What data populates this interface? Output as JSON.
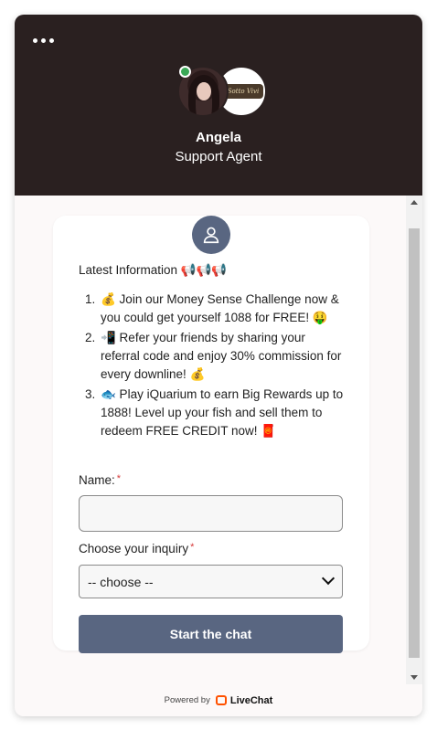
{
  "header": {
    "agent_name": "Angela",
    "agent_role": "Support Agent",
    "brand_logo_text": "Sotto Vivi"
  },
  "info": {
    "title": "Latest Information 📢📢📢",
    "items": [
      {
        "num": "1.",
        "text": "💰 Join our Money Sense Challenge now & you could get yourself 1088 for FREE! 🤑"
      },
      {
        "num": "2.",
        "text": "📲 Refer your friends by sharing your referral code and enjoy 30% commission for every downline! 💰"
      },
      {
        "num": "3.",
        "text": "🐟 Play iQuarium to earn Big Rewards up to 1888! Level up your fish and sell them to redeem FREE CREDIT now! 🧧"
      }
    ]
  },
  "form": {
    "name_label": "Name:",
    "name_value": "",
    "inquiry_label": "Choose your inquiry",
    "required_mark": "*",
    "inquiry_selected": "-- choose --",
    "submit_label": "Start the chat"
  },
  "footer": {
    "powered_by": "Powered by",
    "brand": "LiveChat"
  },
  "colors": {
    "header_bg": "#2a2020",
    "accent": "#596681",
    "online": "#3aa856",
    "required": "#d63a3a",
    "livechat": "#ff5100"
  },
  "icons": [
    "menu-dots-icon",
    "user-icon",
    "chevron-down-icon",
    "livechat-logo-icon",
    "online-status-icon"
  ]
}
